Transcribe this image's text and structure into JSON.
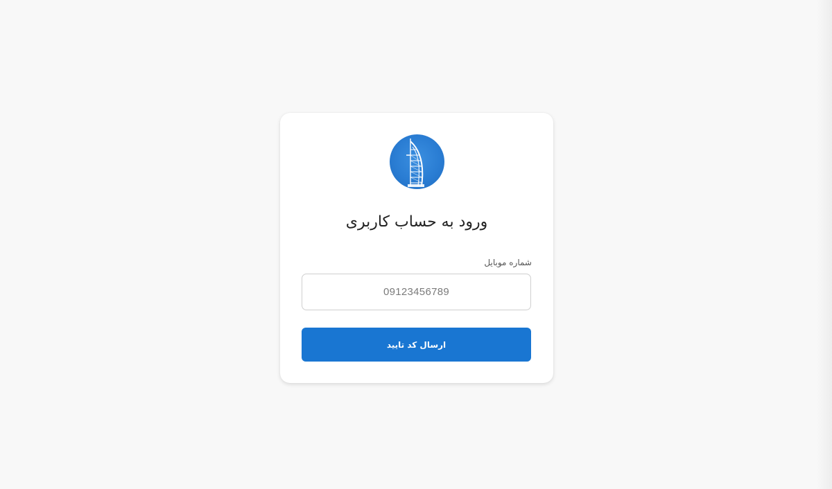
{
  "login": {
    "title": "ورود به حساب کاربری",
    "phone_label": "شماره موبایل",
    "phone_placeholder": "09123456789",
    "phone_value": "",
    "submit_label": "ارسال کد تایید"
  },
  "logo": {
    "icon": "burj-al-arab-logo-icon"
  },
  "colors": {
    "page_background": "#f8f8f8",
    "card_background": "#ffffff",
    "accent": "#1976d2",
    "logo_background": "#2a7dd3"
  }
}
